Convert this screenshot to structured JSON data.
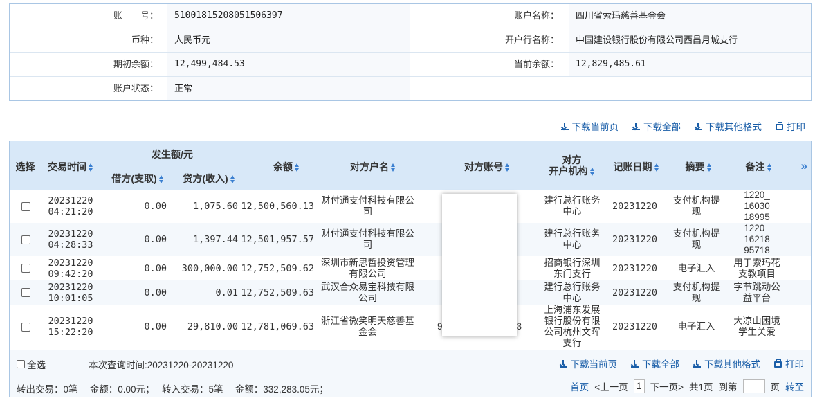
{
  "account": {
    "number_label": "账　　号：",
    "number": "51001815208051506397",
    "name_label": "账户名称：",
    "name": "四川省索玛慈善基金会",
    "currency_label": "币种：",
    "currency": "人民币元",
    "bank_label": "开户行名称：",
    "bank": "中国建设银行股份有限公司西昌月城支行",
    "opening_label": "期初余额：",
    "opening": "12,499,484.53",
    "current_label": "当前余额：",
    "current": "12,829,485.61",
    "status_label": "账户状态：",
    "status": "正常"
  },
  "toolbar": {
    "download_current": "下载当前页",
    "download_all": "下载全部",
    "download_other": "下载其他格式",
    "print": "打印"
  },
  "table": {
    "headers": {
      "select": "选择",
      "time": "交易时间",
      "amount_group": "发生额/元",
      "debit": "借方(支取)",
      "credit": "贷方(收入)",
      "balance": "余额",
      "counterparty": "对方户名",
      "counter_account": "对方账号",
      "counter_bank": "对方\n开户机构",
      "post_date": "记账日期",
      "summary": "摘要",
      "remark": "备注",
      "more": "»"
    },
    "rows": [
      {
        "time": "20231220\n04:21:20",
        "debit": "0.00",
        "credit": "1,075.60",
        "balance": "12,500,560.13",
        "name": "财付通支付科技有限公\n司",
        "bank": "建行总行账务\n中心",
        "date": "20231220",
        "summary": "支付机构提\n现",
        "remark": "1220_\n16030\n18995"
      },
      {
        "time": "20231220\n04:28:33",
        "debit": "0.00",
        "credit": "1,397.44",
        "balance": "12,501,957.57",
        "name": "财付通支付科技有限公\n司",
        "bank": "建行总行账务\n中心",
        "date": "20231220",
        "summary": "支付机构提\n现",
        "remark": "1220_\n16218\n95718"
      },
      {
        "time": "20231220\n09:42:20",
        "debit": "0.00",
        "credit": "300,000.00",
        "balance": "12,752,509.62",
        "name": "深圳市新思哲投资管理\n有限公司",
        "bank": "招商银行深圳\n东门支行",
        "date": "20231220",
        "summary": "电子汇入",
        "remark": "用于索玛花\n支教项目"
      },
      {
        "time": "20231220\n10:01:05",
        "debit": "0.00",
        "credit": "0.01",
        "balance": "12,752,509.63",
        "name": "武汉合众易宝科技有限\n公司",
        "bank": "建行总行账务\n中心",
        "date": "20231220",
        "summary": "支付机构提\n现",
        "remark": "字节跳动公\n益平台"
      },
      {
        "time": "20231220\n15:22:20",
        "debit": "0.00",
        "credit": "29,810.00",
        "balance": "12,781,069.63",
        "name": "浙江省微笑明天慈善基\n金会",
        "bank": "上海浦东发展\n银行股份有限\n公司杭州文晖\n支行",
        "date": "20231220",
        "summary": "电子汇入",
        "remark": "大凉山困境\n学生关爱"
      }
    ]
  },
  "footer": {
    "select_all": "全选",
    "query_time": "本次查询时间:20231220-20231220",
    "summary": "转出交易：0笔　 金额：0.00元；　 转入交易：5笔　 金额：332,283.05元；",
    "first": "首页",
    "prev": "<上一页",
    "page": "1",
    "next": "下一页>",
    "total": "共1页",
    "goto_label": "到第",
    "goto_suffix": "页",
    "goto_button": "转至"
  },
  "partial_visible": {
    "row5_account_fragment_left": "9",
    "row5_account_fragment_right": "3"
  }
}
